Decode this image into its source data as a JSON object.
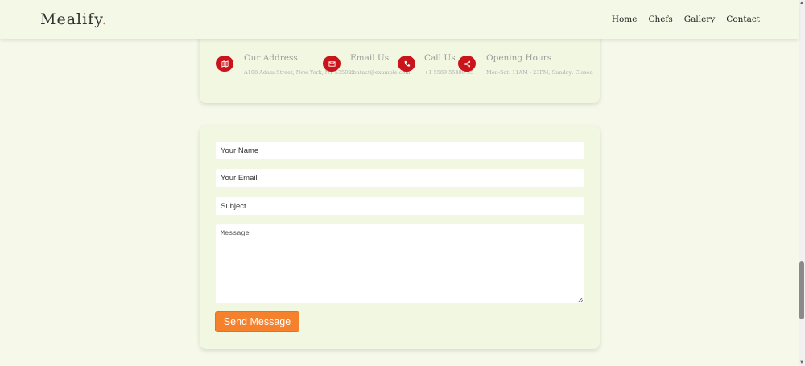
{
  "brand": {
    "name": "Mealify",
    "dot": "."
  },
  "nav": {
    "items": [
      "Home",
      "Chefs",
      "Gallery",
      "Contact"
    ]
  },
  "contact_info": [
    {
      "icon": "map-icon",
      "title": "Our Address",
      "text": "A108 Adam Street, New York, NY 535022"
    },
    {
      "icon": "envelope-icon",
      "title": "Email Us",
      "text": "contact@example.com"
    },
    {
      "icon": "phone-icon",
      "title": "Call Us",
      "text": "+1 5589 55488 55"
    },
    {
      "icon": "share-icon",
      "title": "Opening Hours",
      "text": "Mon-Sat: 11AM - 23PM; Sunday: Closed"
    }
  ],
  "form": {
    "name_placeholder": "Your Name",
    "email_placeholder": "Your Email",
    "subject_placeholder": "Subject",
    "message_placeholder": "Message",
    "submit_label": "Send Message"
  },
  "colors": {
    "background": "#f6f9ea",
    "icon_red": "#c8141a",
    "button_orange": "#f6812d",
    "logo_dot": "#e0761c"
  }
}
